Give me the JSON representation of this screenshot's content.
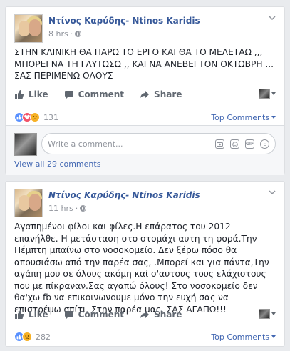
{
  "posts": [
    {
      "author": "Ντίνος Καρύδης- Ntinos Karidis",
      "time": "8 hrs",
      "body": "ΣΤΗΝ ΚΛΙΝΙΚΗ ΘΑ ΠΑΡΩ ΤΟ ΕΡΓΟ ΚΑΙ ΘΑ ΤΟ ΜΕΛΕΤΑΩ ,,, ΜΠΟΡΕΙ ΝΑ ΤΗ ΓΛΥΤΩΣΩ ,, ΚΑΙ ΝΑ ΑΝΕΒΕΙ ΤΟΝ ΟΚΤΩΒΡΗ ...\nΣΑΣ ΠΕΡΙΜΕΝΩ ΟΛΟΥΣ",
      "actions": {
        "like": "Like",
        "comment": "Comment",
        "share": "Share"
      },
      "reaction_count": "131",
      "reactions": [
        "like",
        "love",
        "sad"
      ],
      "top_comments": "Top Comments",
      "composer_placeholder": "Write a comment...",
      "composer_icons": [
        "camera-icon",
        "sticker-icon",
        "gif-icon",
        "emoji-icon"
      ],
      "gif_label": "GIF",
      "view_all": "View all 29 comments"
    },
    {
      "author": "Ντίνος Καρύδης- Ntinos Karidis",
      "time": "11 hrs",
      "body": "Αγαπημένοι φίλοι και φίλες.Η επάρατος του 2012 επανήλθε. Η μετάσταση στο στομάχι αυτη τη φορά.Την Πέμπτη μπαίνω στο νοσοκομείο. Δεν ξέρω πόσο θα απουσιάσω από την παρέα σας, .Μπορεί και για πάντα,Την αγάπη μου σε όλους ακόμη καί σ'αυτους τους ελάχιστους που με πίκραναν.Σας αγαπώ όλους! Στο νοσοκομείο δεν θα'χω fb να επικοινωνουμε μόνο την ευχή σας να επιστρέψω σπίτι. Στην παρέα μας, ΣΑΣ ΑΓΑΠΩ!!!",
      "actions": {
        "like": "Like",
        "comment": "Comment",
        "share": "Share"
      },
      "reaction_count": "282",
      "reactions": [
        "like",
        "sad"
      ],
      "top_comments": "Top Comments"
    }
  ],
  "colors": {
    "link": "#365899",
    "accent": "#4267b2",
    "muted": "#90949c",
    "like": "#5890ff",
    "love": "#f25268",
    "sad": "#f7b125"
  }
}
